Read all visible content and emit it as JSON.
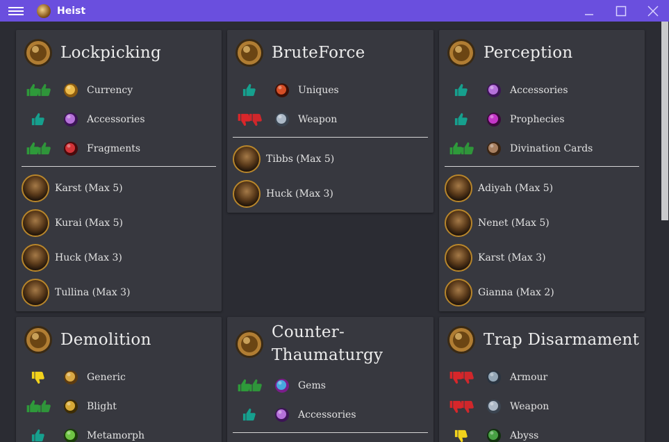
{
  "window": {
    "title": "Heist"
  },
  "cards": [
    {
      "title": "Lockpicking",
      "icon": "lockpicking-icon",
      "rewards": [
        {
          "label": "Currency",
          "rating": "double-up",
          "icon": "currency-icon"
        },
        {
          "label": "Accessories",
          "rating": "single-up",
          "icon": "accessories-icon"
        },
        {
          "label": "Fragments",
          "rating": "double-up",
          "icon": "fragments-icon"
        }
      ],
      "characters": [
        "Karst (Max 5)",
        "Kurai (Max 5)",
        "Huck (Max 3)",
        "Tullina (Max 3)"
      ]
    },
    {
      "title": "BruteForce",
      "icon": "bruteforce-icon",
      "rewards": [
        {
          "label": "Uniques",
          "rating": "single-up",
          "icon": "uniques-icon"
        },
        {
          "label": "Weapon",
          "rating": "double-down",
          "icon": "weapon-icon"
        }
      ],
      "characters": [
        "Tibbs (Max 5)",
        "Huck (Max 3)"
      ]
    },
    {
      "title": "Perception",
      "icon": "perception-icon",
      "rewards": [
        {
          "label": "Accessories",
          "rating": "single-up",
          "icon": "accessories-icon"
        },
        {
          "label": "Prophecies",
          "rating": "single-up",
          "icon": "prophecies-icon"
        },
        {
          "label": "Divination Cards",
          "rating": "double-up",
          "icon": "divination-cards-icon"
        }
      ],
      "characters": [
        "Adiyah (Max 5)",
        "Nenet (Max 5)",
        "Karst (Max 3)",
        "Gianna (Max 2)"
      ]
    },
    {
      "title": "Demolition",
      "icon": "demolition-icon",
      "rewards": [
        {
          "label": "Generic",
          "rating": "single-down",
          "icon": "generic-icon"
        },
        {
          "label": "Blight",
          "rating": "double-up",
          "icon": "blight-icon"
        },
        {
          "label": "Metamorph",
          "rating": "single-up",
          "icon": "metamorph-icon"
        }
      ],
      "characters": []
    },
    {
      "title": "Counter-Thaumaturgy",
      "title_lines": [
        "Counter-",
        "Thaumaturgy"
      ],
      "icon": "counter-thaumaturgy-icon",
      "rewards": [
        {
          "label": "Gems",
          "rating": "double-up",
          "icon": "gems-icon"
        },
        {
          "label": "Accessories",
          "rating": "single-up",
          "icon": "accessories-icon"
        }
      ],
      "characters": []
    },
    {
      "title": "Trap Disarmament",
      "icon": "trap-disarmament-icon",
      "rewards": [
        {
          "label": "Armour",
          "rating": "double-down",
          "icon": "armour-icon"
        },
        {
          "label": "Weapon",
          "rating": "double-down",
          "icon": "weapon-icon"
        },
        {
          "label": "Abyss",
          "rating": "single-down",
          "icon": "abyss-icon"
        }
      ],
      "characters": []
    }
  ],
  "colors": {
    "titlebar": "#6a4fde",
    "background": "#2b2c33",
    "card": "#37383f",
    "up_green": "#2e9a3a",
    "up_teal": "#16a08e",
    "down_red": "#d8262a",
    "down_yellow": "#f2d21c"
  }
}
